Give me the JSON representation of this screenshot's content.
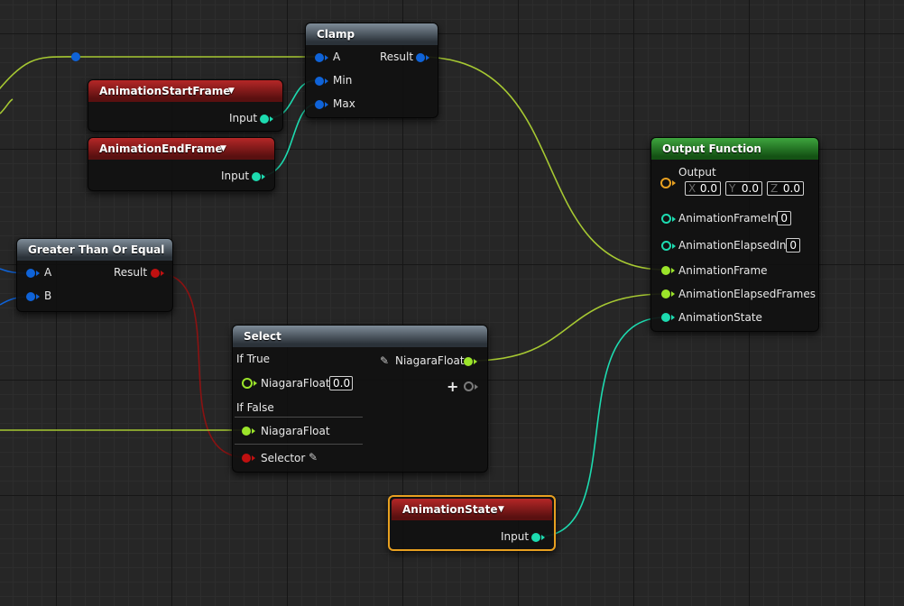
{
  "nodes": {
    "clamp": {
      "title": "Clamp",
      "pins": {
        "a": "A",
        "min": "Min",
        "max": "Max",
        "result": "Result"
      }
    },
    "animation_start_frame": {
      "title": "AnimationStartFrame",
      "output": "Input"
    },
    "animation_end_frame": {
      "title": "AnimationEndFrame",
      "output": "Input"
    },
    "greater_than_or_equal": {
      "title": "Greater Than Or Equal",
      "pins": {
        "a": "A",
        "b": "B",
        "result": "Result"
      }
    },
    "select": {
      "title": "Select",
      "output": "NiagaraFloat",
      "if_true": {
        "label": "If True",
        "pin": "NiagaraFloat",
        "value": "0.0"
      },
      "if_false": {
        "label": "If False",
        "pin": "NiagaraFloat"
      },
      "selector": "Selector",
      "add_pin_symbol": "+"
    },
    "animation_state": {
      "title": "AnimationState",
      "output": "Input",
      "selected": true
    },
    "output_function": {
      "title": "Output Function",
      "output": {
        "label": "Output",
        "x_axis": "X",
        "y_axis": "Y",
        "z_axis": "Z",
        "x": "0.0",
        "y": "0.0",
        "z": "0.0"
      },
      "pins": [
        {
          "label": "AnimationFrameInt",
          "value": "0",
          "connected": false
        },
        {
          "label": "AnimationElapsedInt",
          "value": "0",
          "connected": false
        },
        {
          "label": "AnimationFrame",
          "connected": true
        },
        {
          "label": "AnimationElapsedFrames",
          "connected": true
        },
        {
          "label": "AnimationState",
          "connected": true
        }
      ]
    }
  },
  "colors": {
    "grid_background": "#262626",
    "header_red": "#b52727",
    "header_grey": "#7e8c98",
    "header_green": "#3ea53e",
    "pin_blue": "#0f63d8",
    "pin_teal": "#1ddbb0",
    "pin_green": "#9be42a",
    "pin_red": "#c01010",
    "selection_orange": "#e8a020"
  },
  "icons": {
    "dropdown": "caret-down-icon",
    "edit": "pencil-icon",
    "add": "plus-icon"
  }
}
